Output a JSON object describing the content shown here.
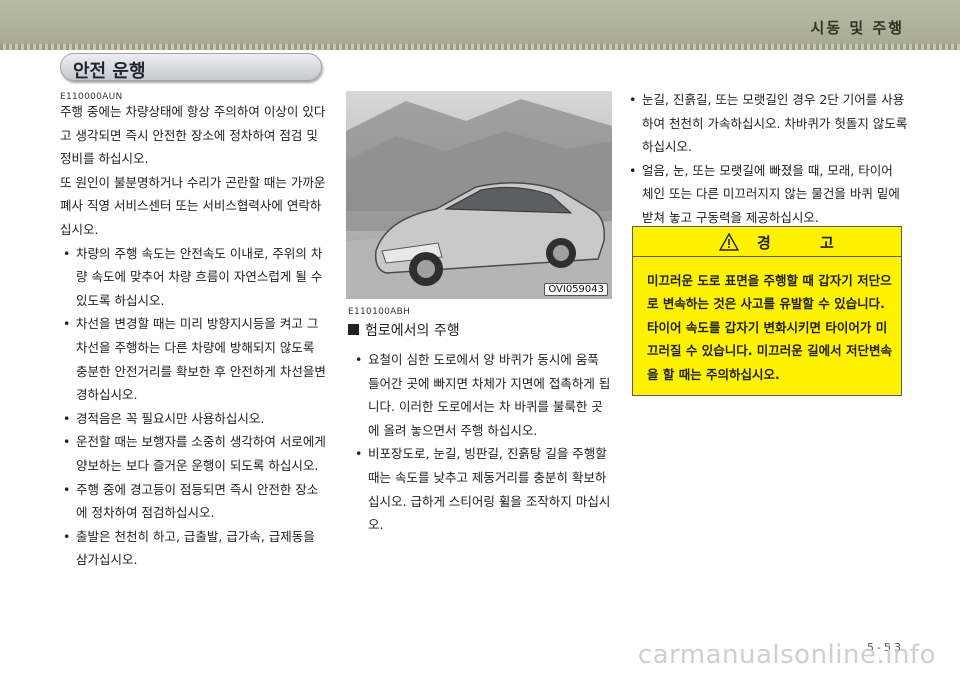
{
  "header": {
    "chapter_title": "시동 및 주행"
  },
  "section": {
    "title": "안전 운행",
    "code": "E110000AUN"
  },
  "left_column": {
    "paragraphs": [
      "주행 중에는 차량상태에 항상 주의하여 이상이 있다고 생각되면 즉시 안전한 장소에 정차하여 점검 및 정비를 하십시오.",
      "또 원인이 불분명하거나 수리가 곤란할 때는 가까운 폐사 직영 서비스센터 또는 서비스협력사에 연락하십시오."
    ],
    "bullets": [
      "차량의 주행 속도는 안전속도 이내로, 주위의 차량 속도에 맞추어 차량 흐름이 자연스럽게 될 수 있도록 하십시오.",
      "차선을 변경할 때는 미리 방향지시등을 켜고 그 차선을 주행하는 다른 차량에 방해되지 않도록 충분한 안전거리를 확보한 후 안전하게 차선을변경하십시오.",
      "경적음은 꼭 필요시만 사용하십시오.",
      "운전할 때는 보행자를 소중히 생각하여 서로에게 양보하는 보다 즐거운 운행이 되도록 하십시오.",
      "주행 중에 경고등이 점등되면 즉시 안전한 장소에 정차하여 점검하십시오.",
      "출발은 천천히 하고, 급출발, 급가속, 급제동을 삼가십시오."
    ]
  },
  "figure": {
    "label": "OVI059043"
  },
  "middle_column": {
    "code": "E110100ABH",
    "subheading": "험로에서의 주행",
    "bullets": [
      "요철이 심한 도로에서 양 바퀴가 동시에 움푹 들어간 곳에 빠지면 차체가 지면에 접촉하게 됩니다. 이러한 도로에서는 차 바퀴를 불룩한 곳에 올려 놓으면서 주행 하십시오.",
      "비포장도로, 눈길, 빙판길, 진흙탕 길을 주행할 때는 속도를 낮추고 제동거리를 충분히 확보하십시오. 급하게 스티어링 휠을 조작하지 마십시오."
    ]
  },
  "right_column": {
    "bullets": [
      "눈길, 진흙길, 또는 모랫길인 경우 2단 기어를 사용하여 천천히 가속하십시오. 차바퀴가 헛돌지 않도록 하십시오.",
      "얼음, 눈, 또는 모랫길에 빠졌을 때, 모래, 타이어 체인 또는 다른 미끄러지지 않는 물건을 바퀴 밑에 받쳐 놓고 구동력을 제공하십시오."
    ]
  },
  "warning": {
    "title": "경 고",
    "body": "미끄러운 도로 표면을 주행할 때 갑자기 저단으로 변속하는 것은 사고를 유발할 수 있습니다. 타이어 속도를 갑자기 변화시키면 타이어가 미끄러질 수 있습니다. 미끄러운 길에서 저단변속을 할 때는 주의하십시오."
  },
  "footer": {
    "page_number": "5-53",
    "watermark": "carmanualsonline.info"
  }
}
